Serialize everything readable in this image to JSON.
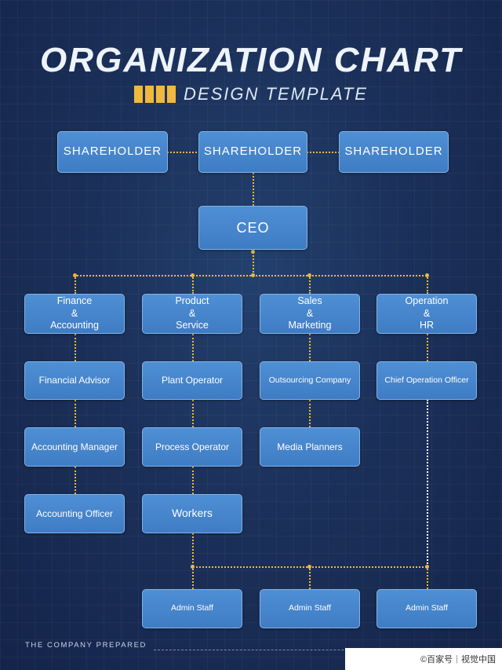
{
  "header": {
    "title": "ORGANIZATION CHART",
    "subtitle": "DESIGN TEMPLATE",
    "accent_color": "#f0b93c",
    "bar_count": 4
  },
  "colors": {
    "background": "#1b2f54",
    "box_fill": "#4f8fd4",
    "box_border": "#7fb4e6",
    "connector": "#f0b93c",
    "connector_white": "#ffffff",
    "text": "#ffffff"
  },
  "nodes": {
    "shareholder_left": "SHAREHOLDER",
    "shareholder_center": "SHAREHOLDER",
    "shareholder_right": "SHAREHOLDER",
    "ceo": "CEO",
    "dept_finance": "Finance\n&\nAccounting",
    "dept_product": "Product\n&\nService",
    "dept_sales": "Sales\n&\nMarketing",
    "dept_operation": "Operation\n&\nHR",
    "finance_1": "Financial Advisor",
    "finance_2": "Accounting Manager",
    "finance_3": "Accounting Officer",
    "product_1": "Plant Operator",
    "product_2": "Process Operator",
    "product_3": "Workers",
    "sales_1": "Outsourcing Company",
    "sales_2": "Media Planners",
    "operation_1": "Chief Operation Officer",
    "admin_1": "Admin Staff",
    "admin_2": "Admin Staff",
    "admin_3": "Admin Staff"
  },
  "footer": {
    "note": "THE COMPANY PREPARED",
    "watermark_left": "©百家号",
    "watermark_sep": "|",
    "watermark_right": "视觉中国"
  }
}
